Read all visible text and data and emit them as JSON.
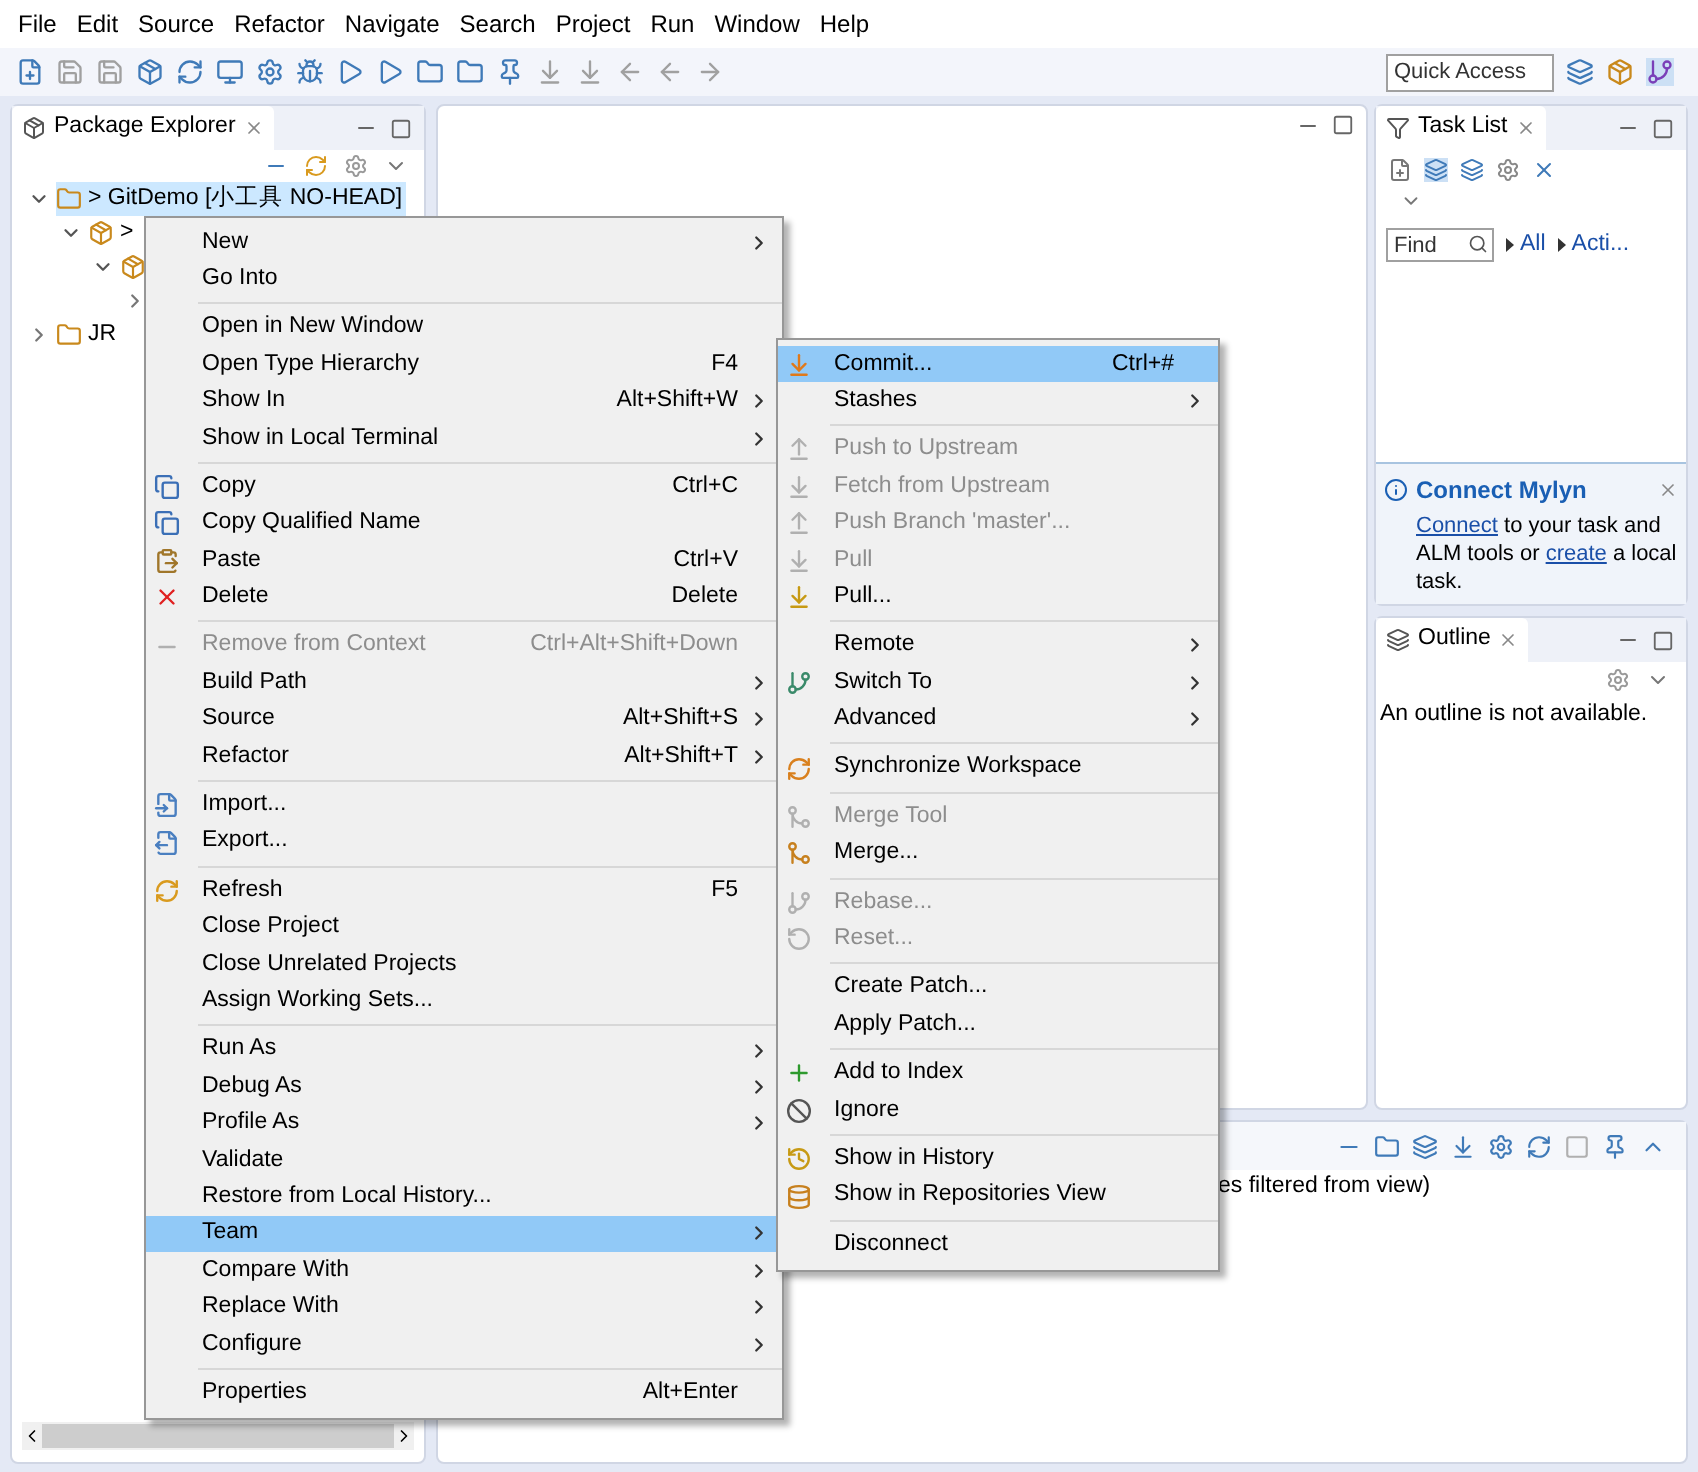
{
  "menubar": [
    "File",
    "Edit",
    "Source",
    "Refactor",
    "Navigate",
    "Search",
    "Project",
    "Run",
    "Window",
    "Help"
  ],
  "quick_access": {
    "placeholder": "Quick Access"
  },
  "package_explorer": {
    "title": "Package Explorer",
    "tree": [
      {
        "label": "> GitDemo [小工具 NO-HEAD]",
        "expanded": true,
        "selected": true,
        "children": [
          {
            "label": ">",
            "expanded": true,
            "selected": false,
            "children": [
              {
                "expanded": true,
                "selected": false,
                "children": [
                  {
                    "expanded": false
                  }
                ]
              }
            ]
          }
        ]
      },
      {
        "label": "JR",
        "expanded": false,
        "selected": false
      }
    ]
  },
  "task_list": {
    "title": "Task List",
    "find": {
      "placeholder": "Find"
    },
    "filters": [
      "All",
      "Acti..."
    ],
    "mylyn": {
      "title": "Connect Mylyn",
      "link_1": "Connect",
      "text_1": " to your task and ALM tools or ",
      "link_2": "create",
      "text_2": " a local task."
    }
  },
  "outline": {
    "title": "Outline",
    "message": "An outline is not available."
  },
  "bottom_panel": {
    "status": "es filtered from view)"
  },
  "context_menu": {
    "items": [
      {
        "kind": "item",
        "label": "New",
        "submenu": true,
        "disabled": false,
        "selected": false
      },
      {
        "kind": "item",
        "label": "Go Into",
        "submenu": false,
        "disabled": false,
        "selected": false
      },
      {
        "kind": "separator"
      },
      {
        "kind": "item",
        "label": "Open in New Window",
        "submenu": false,
        "disabled": false,
        "selected": false
      },
      {
        "kind": "item",
        "label": "Open Type Hierarchy",
        "shortcut": "F4",
        "submenu": false,
        "disabled": false,
        "selected": false
      },
      {
        "kind": "item",
        "label": "Show In",
        "shortcut": "Alt+Shift+W",
        "submenu": true,
        "disabled": false,
        "selected": false
      },
      {
        "kind": "item",
        "label": "Show in Local Terminal",
        "submenu": true,
        "disabled": false,
        "selected": false
      },
      {
        "kind": "separator"
      },
      {
        "kind": "item",
        "label": "Copy",
        "shortcut": "Ctrl+C",
        "submenu": false,
        "disabled": false,
        "selected": false
      },
      {
        "kind": "item",
        "label": "Copy Qualified Name",
        "submenu": false,
        "disabled": false,
        "selected": false
      },
      {
        "kind": "item",
        "label": "Paste",
        "shortcut": "Ctrl+V",
        "submenu": false,
        "disabled": false,
        "selected": false
      },
      {
        "kind": "item",
        "label": "Delete",
        "shortcut": "Delete",
        "submenu": false,
        "disabled": false,
        "selected": false
      },
      {
        "kind": "separator"
      },
      {
        "kind": "item",
        "label": "Remove from Context",
        "shortcut": "Ctrl+Alt+Shift+Down",
        "submenu": false,
        "disabled": true,
        "selected": false
      },
      {
        "kind": "item",
        "label": "Build Path",
        "submenu": true,
        "disabled": false,
        "selected": false
      },
      {
        "kind": "item",
        "label": "Source",
        "shortcut": "Alt+Shift+S",
        "submenu": true,
        "disabled": false,
        "selected": false
      },
      {
        "kind": "item",
        "label": "Refactor",
        "shortcut": "Alt+Shift+T",
        "submenu": true,
        "disabled": false,
        "selected": false
      },
      {
        "kind": "separator"
      },
      {
        "kind": "item",
        "label": "Import...",
        "submenu": false,
        "disabled": false,
        "selected": false
      },
      {
        "kind": "item",
        "label": "Export...",
        "submenu": false,
        "disabled": false,
        "selected": false
      },
      {
        "kind": "separator"
      },
      {
        "kind": "item",
        "label": "Refresh",
        "shortcut": "F5",
        "submenu": false,
        "disabled": false,
        "selected": false
      },
      {
        "kind": "item",
        "label": "Close Project",
        "submenu": false,
        "disabled": false,
        "selected": false
      },
      {
        "kind": "item",
        "label": "Close Unrelated Projects",
        "submenu": false,
        "disabled": false,
        "selected": false
      },
      {
        "kind": "item",
        "label": "Assign Working Sets...",
        "submenu": false,
        "disabled": false,
        "selected": false
      },
      {
        "kind": "separator"
      },
      {
        "kind": "item",
        "label": "Run As",
        "submenu": true,
        "disabled": false,
        "selected": false
      },
      {
        "kind": "item",
        "label": "Debug As",
        "submenu": true,
        "disabled": false,
        "selected": false
      },
      {
        "kind": "item",
        "label": "Profile As",
        "submenu": true,
        "disabled": false,
        "selected": false
      },
      {
        "kind": "item",
        "label": "Validate",
        "submenu": false,
        "disabled": false,
        "selected": false
      },
      {
        "kind": "item",
        "label": "Restore from Local History...",
        "submenu": false,
        "disabled": false,
        "selected": false
      },
      {
        "kind": "item",
        "label": "Team",
        "submenu": true,
        "disabled": false,
        "selected": true
      },
      {
        "kind": "item",
        "label": "Compare With",
        "submenu": true,
        "disabled": false,
        "selected": false
      },
      {
        "kind": "item",
        "label": "Replace With",
        "submenu": true,
        "disabled": false,
        "selected": false
      },
      {
        "kind": "item",
        "label": "Configure",
        "submenu": true,
        "disabled": false,
        "selected": false
      },
      {
        "kind": "separator"
      },
      {
        "kind": "item",
        "label": "Properties",
        "shortcut": "Alt+Enter",
        "submenu": false,
        "disabled": false,
        "selected": false
      }
    ]
  },
  "team_submenu": {
    "items": [
      {
        "kind": "item",
        "label": "Commit...",
        "shortcut": "Ctrl+#",
        "submenu": false,
        "disabled": false,
        "selected": true
      },
      {
        "kind": "item",
        "label": "Stashes",
        "submenu": true,
        "disabled": false,
        "selected": false
      },
      {
        "kind": "separator"
      },
      {
        "kind": "item",
        "label": "Push to Upstream",
        "submenu": false,
        "disabled": true,
        "selected": false
      },
      {
        "kind": "item",
        "label": "Fetch from Upstream",
        "submenu": false,
        "disabled": true,
        "selected": false
      },
      {
        "kind": "item",
        "label": "Push Branch 'master'...",
        "submenu": false,
        "disabled": true,
        "selected": false
      },
      {
        "kind": "item",
        "label": "Pull",
        "submenu": false,
        "disabled": true,
        "selected": false
      },
      {
        "kind": "item",
        "label": "Pull...",
        "submenu": false,
        "disabled": false,
        "selected": false
      },
      {
        "kind": "separator"
      },
      {
        "kind": "item",
        "label": "Remote",
        "submenu": true,
        "disabled": false,
        "selected": false
      },
      {
        "kind": "item",
        "label": "Switch To",
        "submenu": true,
        "disabled": false,
        "selected": false
      },
      {
        "kind": "item",
        "label": "Advanced",
        "submenu": true,
        "disabled": false,
        "selected": false
      },
      {
        "kind": "separator"
      },
      {
        "kind": "item",
        "label": "Synchronize Workspace",
        "submenu": false,
        "disabled": false,
        "selected": false
      },
      {
        "kind": "separator"
      },
      {
        "kind": "item",
        "label": "Merge Tool",
        "submenu": false,
        "disabled": true,
        "selected": false
      },
      {
        "kind": "item",
        "label": "Merge...",
        "submenu": false,
        "disabled": false,
        "selected": false
      },
      {
        "kind": "separator"
      },
      {
        "kind": "item",
        "label": "Rebase...",
        "submenu": false,
        "disabled": true,
        "selected": false
      },
      {
        "kind": "item",
        "label": "Reset...",
        "submenu": false,
        "disabled": true,
        "selected": false
      },
      {
        "kind": "separator"
      },
      {
        "kind": "item",
        "label": "Create Patch...",
        "submenu": false,
        "disabled": false,
        "selected": false
      },
      {
        "kind": "item",
        "label": "Apply Patch...",
        "submenu": false,
        "disabled": false,
        "selected": false
      },
      {
        "kind": "separator"
      },
      {
        "kind": "item",
        "label": "Add to Index",
        "submenu": false,
        "disabled": false,
        "selected": false
      },
      {
        "kind": "item",
        "label": "Ignore",
        "submenu": false,
        "disabled": false,
        "selected": false
      },
      {
        "kind": "separator"
      },
      {
        "kind": "item",
        "label": "Show in History",
        "submenu": false,
        "disabled": false,
        "selected": false
      },
      {
        "kind": "item",
        "label": "Show in Repositories View",
        "submenu": false,
        "disabled": false,
        "selected": false
      },
      {
        "kind": "separator"
      },
      {
        "kind": "item",
        "label": "Disconnect",
        "submenu": false,
        "disabled": false,
        "selected": false
      }
    ]
  }
}
